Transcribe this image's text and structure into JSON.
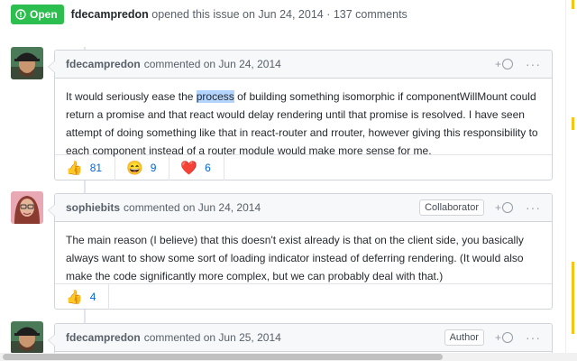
{
  "issue_meta": {
    "state": "Open",
    "author": "fdecampredon",
    "text": "opened this issue on Jun 24, 2014 · 137 comments"
  },
  "comments": [
    {
      "author": "fdecampredon",
      "date_text": "commented on Jun 24, 2014",
      "role": "",
      "body_before": "It would seriously ease the ",
      "body_highlight": "process",
      "body_after": " of building something isomorphic if componentWillMount could return a promise and that react would delay rendering until that promise is resolved. I have seen attempt of doing something like that in react-router and rrouter, however giving this responsibility to each component instead of a router module would make more sense for me.",
      "reactions": [
        {
          "emoji": "👍",
          "count": "81"
        },
        {
          "emoji": "😄",
          "count": "9"
        },
        {
          "emoji": "❤️",
          "count": "6"
        }
      ]
    },
    {
      "author": "sophiebits",
      "date_text": "commented on Jun 24, 2014",
      "role": "Collaborator",
      "body": "The main reason (I believe) that this doesn't exist already is that on the client side, you basically always want to show some sort of loading indicator instead of deferring rendering. (It would also make the code significantly more complex, but we can probably deal with that.)",
      "reactions": [
        {
          "emoji": "👍",
          "count": "4"
        }
      ]
    },
    {
      "author": "fdecampredon",
      "date_text": "commented on Jun 25, 2014",
      "role": "Author"
    }
  ],
  "labels": {
    "add_reaction": "+",
    "more": "···"
  },
  "icons": {
    "state": "issue-opened-icon",
    "add_reaction": "smiley-icon",
    "more": "kebab-horizontal-icon"
  },
  "colors": {
    "open_green": "#2cbe4e",
    "link_blue": "#0366d6",
    "highlight": "#b3d4fd",
    "scroll_marker": "#f9c513"
  }
}
